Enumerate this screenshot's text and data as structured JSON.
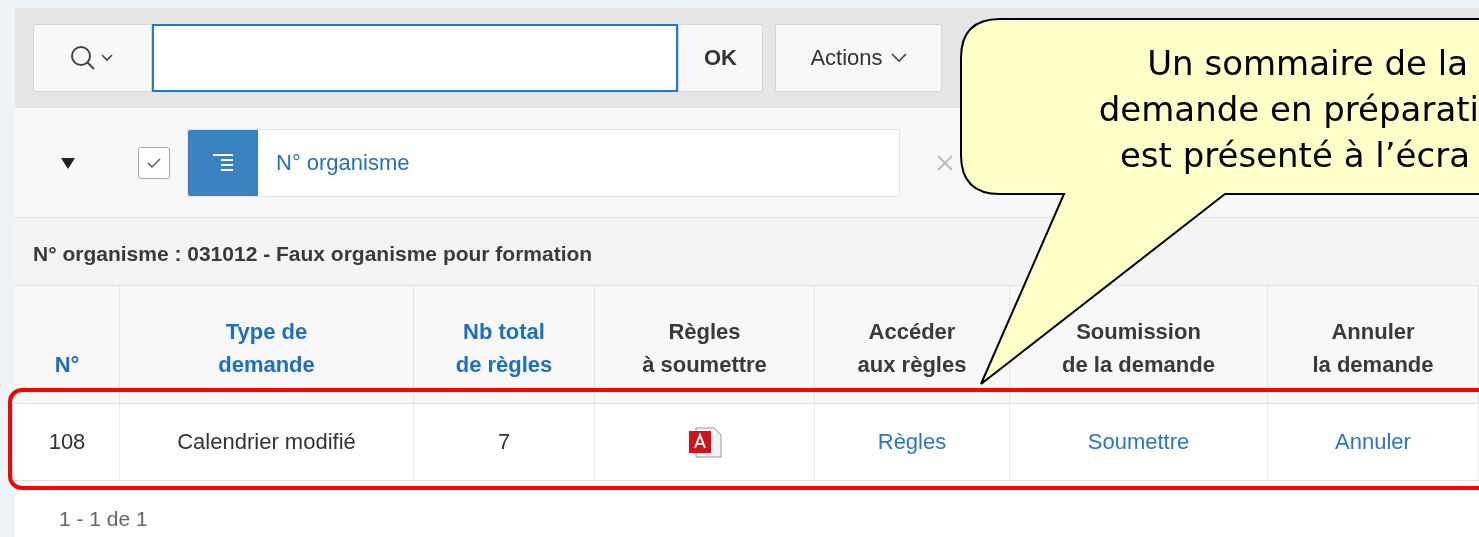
{
  "toolbar": {
    "ok_button": "OK",
    "actions_button": "Actions"
  },
  "filter": {
    "expanded": true,
    "enabled": true,
    "label": "N° organisme"
  },
  "group_heading": "N° organisme : 031012 - Faux organisme pour formation",
  "table": {
    "columns": [
      {
        "label": "N°",
        "sortable": true
      },
      {
        "label": "Type de\ndemande",
        "sortable": true
      },
      {
        "label": "Nb total\nde règles",
        "sortable": true
      },
      {
        "label": "Règles\nà soumettre",
        "sortable": false
      },
      {
        "label": "Accéder\naux règles",
        "sortable": false
      },
      {
        "label": "Soumission\nde la demande",
        "sortable": false
      },
      {
        "label": "Annuler\nla demande",
        "sortable": false
      }
    ],
    "rows": [
      {
        "cells": [
          {
            "kind": "text",
            "text": "108"
          },
          {
            "kind": "text",
            "text": "Calendrier modifié"
          },
          {
            "kind": "text",
            "text": "7"
          },
          {
            "kind": "pdf"
          },
          {
            "kind": "link",
            "text": "Règles"
          },
          {
            "kind": "link",
            "text": "Soumettre"
          },
          {
            "kind": "link",
            "text": "Annuler"
          }
        ]
      }
    ]
  },
  "pagination": "1 - 1 de 1",
  "callout": {
    "lines": [
      "Un sommaire de la",
      "demande en préparati",
      "est présenté à l’écra"
    ]
  }
}
